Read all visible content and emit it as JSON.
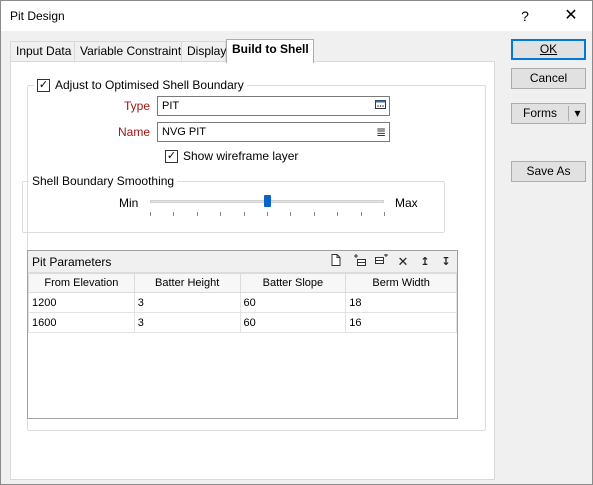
{
  "window": {
    "title": "Pit Design",
    "help_label": "?",
    "close_label": "✕"
  },
  "tabs": [
    {
      "label": "Input Data"
    },
    {
      "label": "Variable Constraints"
    },
    {
      "label": "Display"
    },
    {
      "label": "Build to Shell"
    }
  ],
  "shell": {
    "adjust_label": "Adjust to Optimised Shell Boundary",
    "adjust_checked": "✓",
    "type_label": "Type",
    "type_value": "PIT",
    "name_label": "Name",
    "name_value": "NVG PIT",
    "wireframe_label": "Show wireframe layer",
    "wireframe_checked": "✓"
  },
  "smoothing": {
    "title": "Shell Boundary Smoothing",
    "min_label": "Min",
    "max_label": "Max",
    "value_fraction": 0.5
  },
  "pit_parameters": {
    "title": "Pit Parameters",
    "columns": [
      "From Elevation",
      "Batter Height",
      "Batter Slope",
      "Berm Width"
    ],
    "rows": [
      [
        "1200",
        "3",
        "60",
        "18"
      ],
      [
        "1600",
        "3",
        "60",
        "16"
      ]
    ],
    "tools": [
      "new-icon",
      "insert-row-icon",
      "add-row-icon",
      "delete-icon",
      "move-up-icon",
      "move-down-icon"
    ]
  },
  "buttons": {
    "ok": "OK",
    "cancel": "Cancel",
    "forms": "Forms",
    "forms_arrow": "▾",
    "save_as": "Save As"
  }
}
